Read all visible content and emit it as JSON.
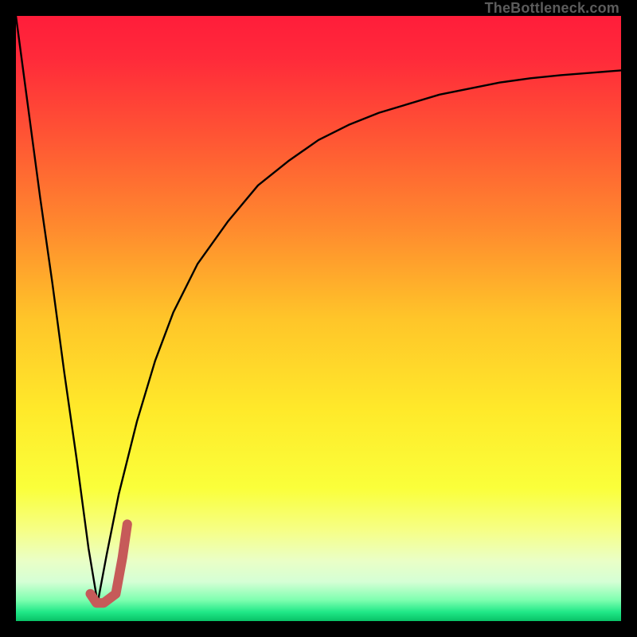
{
  "attribution": "TheBottleneck.com",
  "colors": {
    "frame": "#000000",
    "gradient_stops": [
      {
        "offset": 0.0,
        "color": "#ff1d3a"
      },
      {
        "offset": 0.07,
        "color": "#ff2a3a"
      },
      {
        "offset": 0.2,
        "color": "#ff5534"
      },
      {
        "offset": 0.35,
        "color": "#ff8a2e"
      },
      {
        "offset": 0.5,
        "color": "#ffc529"
      },
      {
        "offset": 0.65,
        "color": "#ffe92a"
      },
      {
        "offset": 0.78,
        "color": "#faff3a"
      },
      {
        "offset": 0.85,
        "color": "#f6ff86"
      },
      {
        "offset": 0.9,
        "color": "#eaffc6"
      },
      {
        "offset": 0.935,
        "color": "#d5ffd5"
      },
      {
        "offset": 0.965,
        "color": "#7fffb0"
      },
      {
        "offset": 0.985,
        "color": "#20e887"
      },
      {
        "offset": 1.0,
        "color": "#09c267"
      }
    ],
    "curve": "#000000",
    "marker": "#c65a59"
  },
  "chart_data": {
    "type": "line",
    "title": "",
    "xlabel": "",
    "ylabel": "",
    "xlim": [
      0,
      100
    ],
    "ylim": [
      0,
      100
    ],
    "series": [
      {
        "name": "left-branch",
        "x": [
          0,
          2,
          4,
          6,
          8,
          10,
          12,
          13.5
        ],
        "values": [
          100,
          85,
          70,
          56,
          41,
          27,
          12,
          3
        ]
      },
      {
        "name": "right-branch",
        "x": [
          13.5,
          15,
          17,
          20,
          23,
          26,
          30,
          35,
          40,
          45,
          50,
          55,
          60,
          65,
          70,
          75,
          80,
          85,
          90,
          95,
          100
        ],
        "values": [
          3,
          11,
          21,
          33,
          43,
          51,
          59,
          66,
          72,
          76,
          79.5,
          82,
          84,
          85.5,
          87,
          88,
          89,
          89.7,
          90.2,
          90.6,
          91
        ]
      }
    ],
    "marker": {
      "name": "highlight-j",
      "points": [
        {
          "x": 12.3,
          "y": 4.5
        },
        {
          "x": 13.3,
          "y": 3.0
        },
        {
          "x": 14.5,
          "y": 3.0
        },
        {
          "x": 16.5,
          "y": 4.5
        },
        {
          "x": 17.6,
          "y": 10.5
        },
        {
          "x": 18.4,
          "y": 16.0
        }
      ]
    }
  }
}
